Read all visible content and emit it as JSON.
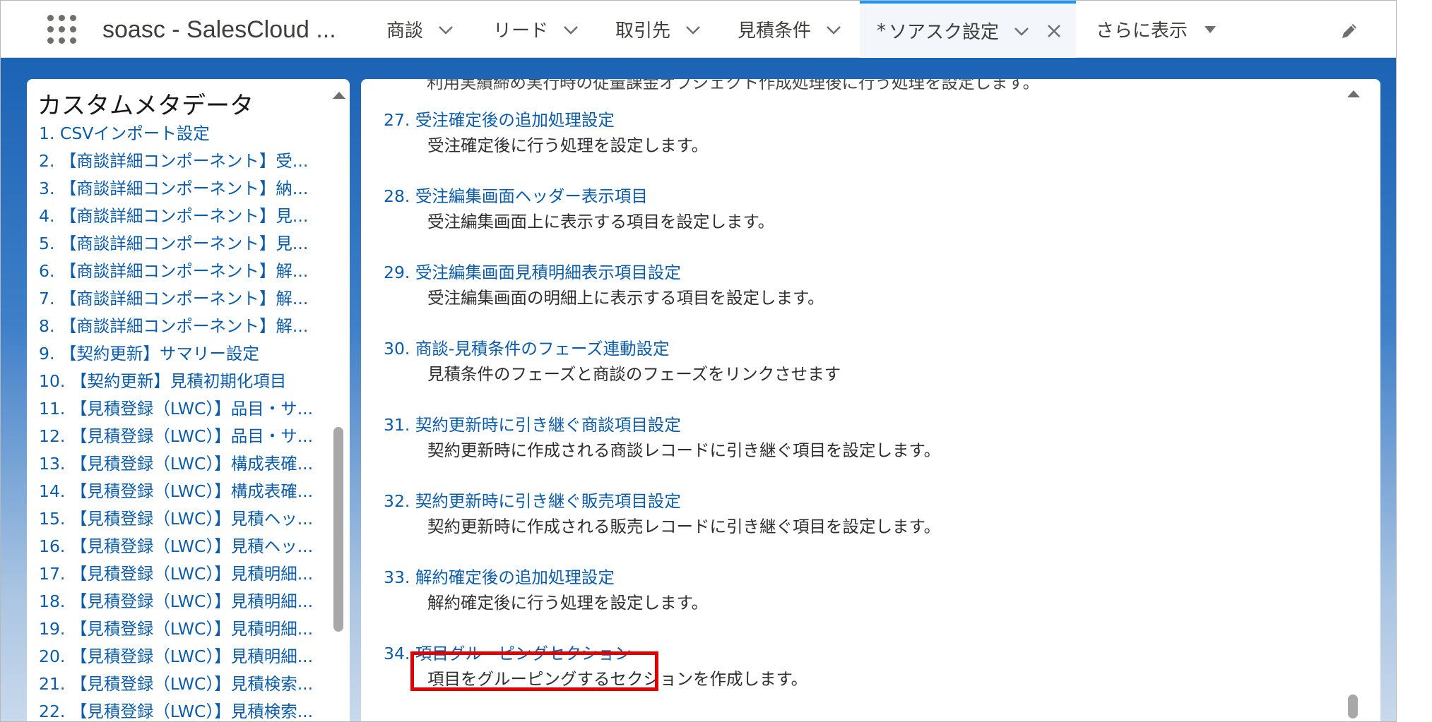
{
  "app": {
    "name": "soasc - SalesCloud ..."
  },
  "nav": {
    "tabs": [
      {
        "label": "商談"
      },
      {
        "label": "リード"
      },
      {
        "label": "取引先"
      },
      {
        "label": "見積条件"
      }
    ],
    "active_tab": {
      "marker": "*",
      "label": "ソアスク設定"
    },
    "more_label": "さらに表示"
  },
  "left_panel": {
    "title": "カスタムメタデータ",
    "items": [
      {
        "num": "1.",
        "label": "CSVインポート設定"
      },
      {
        "num": "2.",
        "label": "【商談詳細コンポーネント】受..."
      },
      {
        "num": "3.",
        "label": "【商談詳細コンポーネント】納..."
      },
      {
        "num": "4.",
        "label": "【商談詳細コンポーネント】見..."
      },
      {
        "num": "5.",
        "label": "【商談詳細コンポーネント】見..."
      },
      {
        "num": "6.",
        "label": "【商談詳細コンポーネント】解..."
      },
      {
        "num": "7.",
        "label": "【商談詳細コンポーネント】解..."
      },
      {
        "num": "8.",
        "label": "【商談詳細コンポーネント】解..."
      },
      {
        "num": "9.",
        "label": "【契約更新】サマリー設定"
      },
      {
        "num": "10.",
        "label": "【契約更新】見積初期化項目"
      },
      {
        "num": "11.",
        "label": "【見積登録（LWC）】品目・サ..."
      },
      {
        "num": "12.",
        "label": "【見積登録（LWC）】品目・サ..."
      },
      {
        "num": "13.",
        "label": "【見積登録（LWC）】構成表確..."
      },
      {
        "num": "14.",
        "label": "【見積登録（LWC）】構成表確..."
      },
      {
        "num": "15.",
        "label": "【見積登録（LWC）】見積ヘッ..."
      },
      {
        "num": "16.",
        "label": "【見積登録（LWC）】見積ヘッ..."
      },
      {
        "num": "17.",
        "label": "【見積登録（LWC）】見積明細..."
      },
      {
        "num": "18.",
        "label": "【見積登録（LWC）】見積明細..."
      },
      {
        "num": "19.",
        "label": "【見積登録（LWC）】見積明細..."
      },
      {
        "num": "20.",
        "label": "【見積登録（LWC）】見積明細..."
      },
      {
        "num": "21.",
        "label": "【見積登録（LWC）】見積検索..."
      },
      {
        "num": "22.",
        "label": "【見積登録（LWC）】見積検索..."
      }
    ]
  },
  "main_panel": {
    "cut_off_text": "利用実績締め実行時の従量課金オブジェクト作成処理後に行う処理を設定します。",
    "entries": [
      {
        "num": "27.",
        "title": "受注確定後の追加処理設定",
        "desc": "受注確定後に行う処理を設定します。"
      },
      {
        "num": "28.",
        "title": "受注編集画面ヘッダー表示項目",
        "desc": "受注編集画面上に表示する項目を設定します。"
      },
      {
        "num": "29.",
        "title": "受注編集画面見積明細表示項目設定",
        "desc": "受注編集画面の明細上に表示する項目を設定します。"
      },
      {
        "num": "30.",
        "title": "商談-見積条件のフェーズ連動設定",
        "desc": "見積条件のフェーズと商談のフェーズをリンクさせます"
      },
      {
        "num": "31.",
        "title": "契約更新時に引き継ぐ商談項目設定",
        "desc": "契約更新時に作成される商談レコードに引き継ぐ項目を設定します。"
      },
      {
        "num": "32.",
        "title": "契約更新時に引き継ぐ販売項目設定",
        "desc": "契約更新時に作成される販売レコードに引き継ぐ項目を設定します。"
      },
      {
        "num": "33.",
        "title": "解約確定後の追加処理設定",
        "desc": "解約確定後に行う処理を設定します。"
      },
      {
        "num": "34.",
        "title": "項目グルーピングセクション",
        "desc": "項目をグルーピングするセクションを作成します。"
      }
    ]
  },
  "colors": {
    "link": "#0b5cab",
    "highlight": "#e00000",
    "active_tab_border": "#1b96ff"
  },
  "icons": [
    "app-launcher-icon",
    "chevron-down-icon",
    "close-icon",
    "caret-down-icon",
    "pencil-icon"
  ]
}
